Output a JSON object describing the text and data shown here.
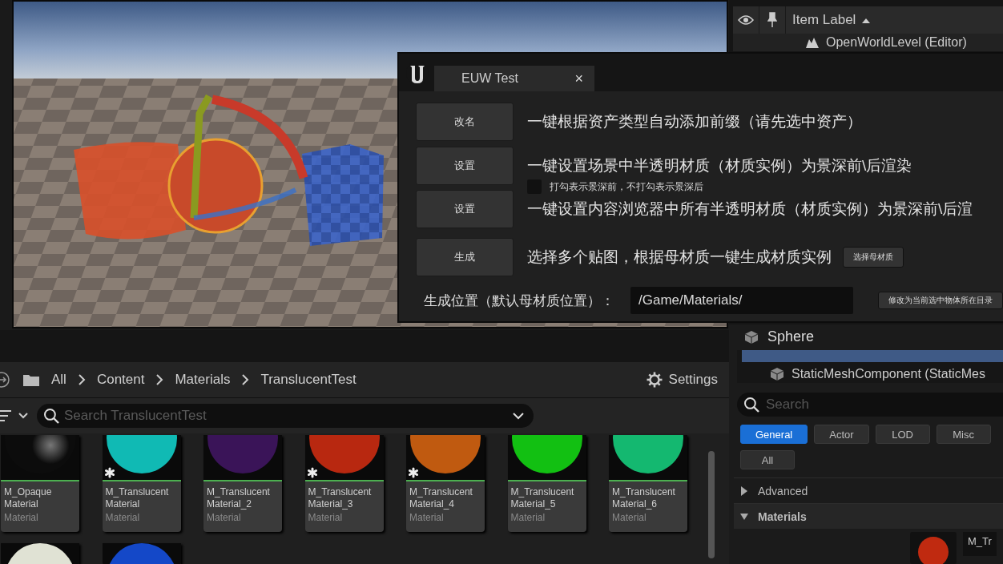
{
  "outliner": {
    "column_header": "Item Label",
    "rows": [
      {
        "label": "OpenWorldLevel (Editor)"
      }
    ]
  },
  "euw_window": {
    "title": "EUW Test",
    "close": "×",
    "rows": [
      {
        "button": "改名",
        "description": "一键根据资产类型自动添加前缀（请先选中资产）"
      },
      {
        "button": "设置",
        "description": "一键设置场景中半透明材质（材质实例）为景深前\\后渲染",
        "checkbox": {
          "label": "打勾表示景深前，不打勾表示景深后",
          "checked": false
        }
      },
      {
        "button": "设置",
        "description": "一键设置内容浏览器中所有半透明材质（材质实例）为景深前\\后渲"
      },
      {
        "button": "生成",
        "description": "选择多个贴图，根据母材质一键生成材质实例",
        "extra_button": "选择母材质"
      }
    ],
    "path_row": {
      "label": "生成位置（默认母材质位置）：",
      "value": "/Game/Materials/",
      "button": "修改为当前选中物体所在目录"
    }
  },
  "content_browser": {
    "breadcrumb": [
      "All",
      "Content",
      "Materials",
      "TranslucentTest"
    ],
    "settings": "Settings",
    "search": {
      "placeholder": "Search TranslucentTest"
    },
    "assets": [
      {
        "name_lines": [
          "M_Opaque",
          "Material"
        ],
        "type": "Material",
        "color": "#0c0c0c",
        "modified": false
      },
      {
        "name_lines": [
          "M_Translucent",
          "Material"
        ],
        "type": "Material",
        "color": "#10bab4",
        "modified": true
      },
      {
        "name_lines": [
          "M_Translucent",
          "Material_2"
        ],
        "type": "Material",
        "color": "#3a1458",
        "modified": false
      },
      {
        "name_lines": [
          "M_Translucent",
          "Material_3"
        ],
        "type": "Material",
        "color": "#b82810",
        "modified": true
      },
      {
        "name_lines": [
          "M_Translucent",
          "Material_4"
        ],
        "type": "Material",
        "color": "#c05a10",
        "modified": true
      },
      {
        "name_lines": [
          "M_Translucent",
          "Material_5"
        ],
        "type": "Material",
        "color": "#12c012",
        "modified": false
      },
      {
        "name_lines": [
          "M_Translucent",
          "Material_6"
        ],
        "type": "Material",
        "color": "#14b870",
        "modified": false
      },
      {
        "color": "#e0e2d4",
        "modified": false
      },
      {
        "color": "#1448c8",
        "modified": false
      }
    ]
  },
  "details": {
    "title": "Sphere",
    "components": [
      {
        "label": "StaticMeshComponent (StaticMes"
      }
    ],
    "search": {
      "placeholder": "Search"
    },
    "filters": [
      {
        "label": "General",
        "selected": true
      },
      {
        "label": "Actor",
        "selected": false
      },
      {
        "label": "LOD",
        "selected": false
      },
      {
        "label": "Misc",
        "selected": false
      },
      {
        "label": "All",
        "selected": false
      }
    ],
    "sections": [
      {
        "label": "Advanced",
        "expanded": false
      },
      {
        "label": "Materials",
        "expanded": true
      }
    ],
    "material_slot": {
      "name": "M_Tr",
      "color": "#c02a10"
    }
  }
}
